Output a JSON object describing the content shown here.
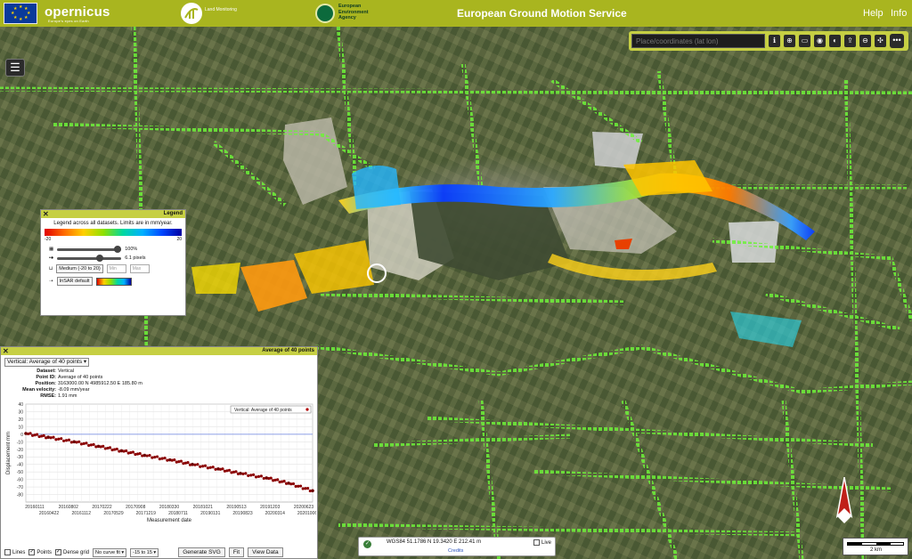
{
  "header": {
    "app_title": "European Ground Motion Service",
    "help_label": "Help",
    "info_label": "Info",
    "copernicus_label": "opernicus",
    "copernicus_tagline": "Europe's eyes on Earth",
    "land_monitoring_label": "Land Monitoring",
    "eea_label": "European Environment Agency"
  },
  "toolbar": {
    "search_placeholder": "Place/coordinates (lat lon)",
    "buttons": [
      "info-icon",
      "globe-icon",
      "layers-icon",
      "basemap-icon",
      "compass-icon",
      "share-icon",
      "download-icon",
      "network-icon",
      "more-icon"
    ]
  },
  "legend": {
    "title": "Legend",
    "description": "Legend across all datasets. Limits are in mm/year.",
    "min_label": "-20",
    "max_label": "20",
    "opacity_value": "100%",
    "size_value": "6.1 pixels",
    "range_select": "Medium (-20 to 20)",
    "min_placeholder": "Min",
    "max_placeholder": "Max",
    "palette_select": "InSAR default"
  },
  "timeseries": {
    "title": "Average of 40 points",
    "dropdown": "Vertical: Average of 40 points",
    "dataset_label": "Dataset:",
    "dataset_value": "Vertical",
    "pointid_label": "Point ID:",
    "pointid_value": "Average of 40 points",
    "position_label": "Position:",
    "position_value": "3163000.00 N 4985912.50 E 185.80 m",
    "velocity_label": "Mean velocity:",
    "velocity_value": "-8.09 mm/year",
    "rmse_label": "RMSE:",
    "rmse_value": "1.91 mm",
    "lines_label": "Lines",
    "points_label": "Points",
    "dense_grid_label": "Dense grid",
    "curve_fit_select": "No curve fit",
    "range_select": "-15 to 15",
    "generate_svg_label": "Generate SVG",
    "fit_label": "Fit",
    "view_data_label": "View Data"
  },
  "chart_data": {
    "type": "scatter",
    "title": "",
    "legend_entry": "Vertical: Average of 40 points",
    "xlabel": "Measurement date",
    "ylabel": "Displacement mm",
    "ylim": [
      -90,
      40
    ],
    "yticks": [
      "40",
      "30",
      "20",
      "10",
      "0",
      "-10",
      "-20",
      "-30",
      "-40",
      "-50",
      "-60",
      "-70",
      "-80"
    ],
    "xticks_top": [
      "20160111",
      "20160802",
      "20170222",
      "20170908",
      "20180330",
      "20181021",
      "20190513",
      "20191203",
      "20200623"
    ],
    "xticks_bottom": [
      "20160422",
      "20161112",
      "20170529",
      "20171219",
      "20180711",
      "20190131",
      "20190823",
      "20200314",
      "20201006"
    ],
    "x": [
      "2016-01-11",
      "2016-06-01",
      "2016-11-12",
      "2017-04-15",
      "2017-09-08",
      "2018-02-01",
      "2018-07-11",
      "2018-12-01",
      "2019-05-13",
      "2019-10-01",
      "2020-03-14",
      "2020-08-01",
      "2020-12-31"
    ],
    "values": [
      1,
      -4,
      -10,
      -16,
      -22,
      -28,
      -34,
      -40,
      -46,
      -52,
      -58,
      -65,
      -75
    ],
    "grid": true,
    "legend_position": "top-right",
    "reference_line": 0
  },
  "coords": {
    "text": "WGS84 51.1786 N 19.3420 E 212.41 m",
    "credits": "Credits",
    "live_label": "Live"
  },
  "scale": {
    "label": "2 km"
  }
}
